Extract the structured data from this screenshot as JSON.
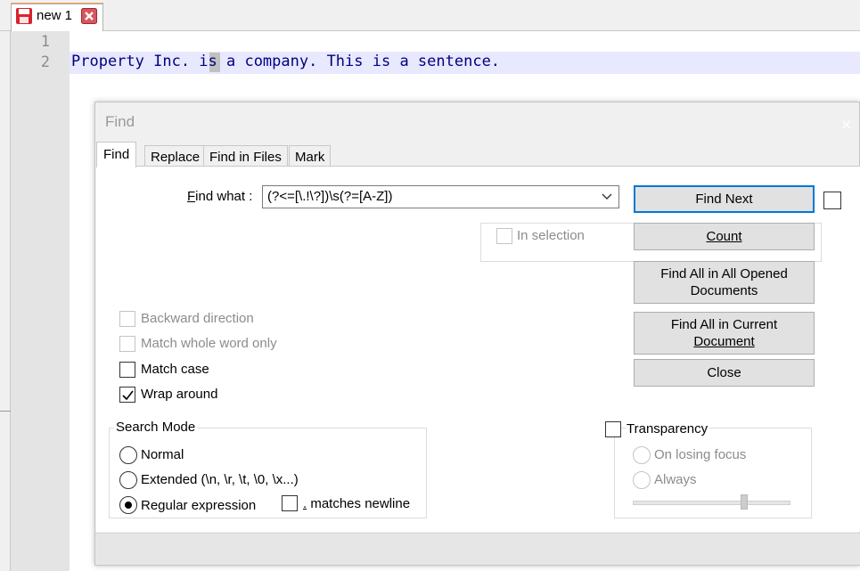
{
  "editor": {
    "tab_label": "new 1",
    "line_numbers": [
      "1",
      "2"
    ],
    "line2_text": "Property Inc. is a company. This is a sentence."
  },
  "dialog": {
    "title": "Find",
    "close_symbol": "×",
    "tabs": [
      "Find",
      "Replace",
      "Find in Files",
      "Mark"
    ],
    "find_what": {
      "label_prefix": "F",
      "label_rest": "ind what :",
      "value": "(?<=[\\.!\\?])\\s(?=[A-Z])"
    },
    "buttons": {
      "find_next": "Find Next",
      "count": "Count",
      "find_all_opened_line1": "Find All in All Opened",
      "find_all_opened_line2": "Documents",
      "find_all_current_line1": "Find All in Current",
      "find_all_current_line2": "Document",
      "close": "Close"
    },
    "in_selection": "In selection",
    "options": {
      "backward": "Backward direction",
      "whole_word": "Match whole word only",
      "match_case": "Match case",
      "wrap_around": "Wrap around"
    },
    "search_mode": {
      "title": "Search Mode",
      "normal": "Normal",
      "extended": "Extended (\\n, \\r, \\t, \\0, \\x...)",
      "regex": "Regular expression",
      "dot_prefix": ".",
      "dot_rest": " matches newline",
      "selected": "Regular expression"
    },
    "transparency": {
      "label": "Transparency",
      "on_losing_focus": "On losing focus",
      "always": "Always",
      "slider_level": 0.7
    },
    "states": {
      "wrap_around_checked": true,
      "match_case_checked": false
    }
  }
}
